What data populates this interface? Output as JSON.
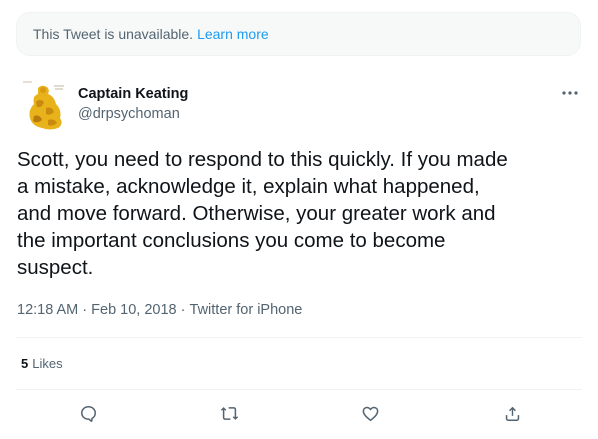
{
  "unavailable_notice": {
    "message": "This Tweet is unavailable.",
    "link_label": "Learn more"
  },
  "author": {
    "name": "Captain Keating",
    "handle": "@drpsychoman",
    "avatar_icon": "yellow-figure-avatar"
  },
  "more_icon": "ellipsis-icon",
  "tweet": {
    "text": "Scott, you need to respond to this quickly.  If you made\na mistake, acknowledge it, explain what happened,\nand move forward. Otherwise, your greater work and\nthe important conclusions you come to become\nsuspect.",
    "time": "12:18 AM",
    "separator": " · ",
    "date": "Feb 10, 2018",
    "source": "Twitter for iPhone"
  },
  "stats": {
    "likes_count": "5",
    "likes_label": "Likes"
  },
  "actions": [
    {
      "name": "reply",
      "icon": "reply-icon"
    },
    {
      "name": "retweet",
      "icon": "retweet-icon"
    },
    {
      "name": "like",
      "icon": "heart-icon"
    },
    {
      "name": "share",
      "icon": "share-icon"
    }
  ],
  "colors": {
    "accent": "#1d9bf0",
    "secondary_text": "#536471",
    "primary_text": "#0f1419",
    "notice_bg": "#f7f9f9",
    "border": "#eff3f4"
  }
}
